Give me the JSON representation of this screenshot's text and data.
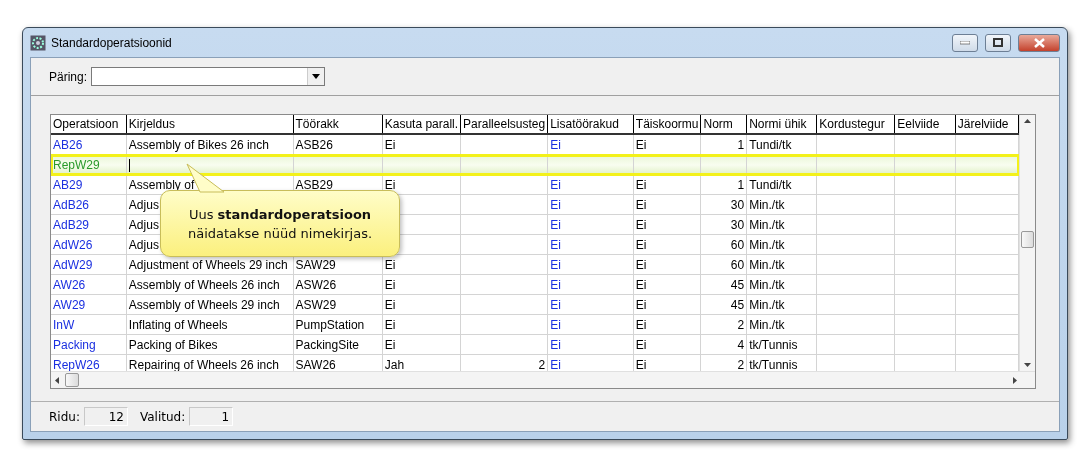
{
  "window": {
    "title": "Standardoperatsioonid"
  },
  "query": {
    "label": "Päring:"
  },
  "table": {
    "columns": [
      {
        "label": "Operatsioon",
        "kind": "link"
      },
      {
        "label": "Kirjeldus",
        "kind": "text"
      },
      {
        "label": "Töörakk",
        "kind": "text"
      },
      {
        "label": "Kasuta parall.",
        "kind": "text"
      },
      {
        "label": "Paralleelsusteg",
        "kind": "number"
      },
      {
        "label": "Lisatöörakud",
        "kind": "link"
      },
      {
        "label": "Täiskoormu",
        "kind": "text"
      },
      {
        "label": "Norm",
        "kind": "number"
      },
      {
        "label": "Normi ühik",
        "kind": "text"
      },
      {
        "label": "Kordustegur",
        "kind": "text"
      },
      {
        "label": "Eelviide",
        "kind": "text"
      },
      {
        "label": "Järelviide",
        "kind": "text"
      }
    ],
    "rows": [
      {
        "selected": false,
        "cells": [
          "AB26",
          "Assembly of Bikes 26 inch",
          "ASB26",
          "Ei",
          null,
          "Ei",
          "Ei",
          "1",
          "Tundi/tk"
        ]
      },
      {
        "selected": true,
        "editing": true,
        "cells": [
          "RepW29"
        ]
      },
      {
        "selected": false,
        "cells": [
          "AB29",
          "Assembly of",
          "ASB29",
          "Ei",
          null,
          "Ei",
          "Ei",
          "1",
          "Tundi/tk"
        ]
      },
      {
        "selected": false,
        "cells": [
          "AdB26",
          "Adjus",
          null,
          null,
          null,
          "Ei",
          "Ei",
          "30",
          "Min./tk"
        ]
      },
      {
        "selected": false,
        "cells": [
          "AdB29",
          "Adjus",
          null,
          null,
          null,
          "Ei",
          "Ei",
          "30",
          "Min./tk"
        ]
      },
      {
        "selected": false,
        "cells": [
          "AdW26",
          "Adjus",
          null,
          null,
          null,
          "Ei",
          "Ei",
          "60",
          "Min./tk"
        ]
      },
      {
        "selected": false,
        "cells": [
          "AdW29",
          "Adjustment of Wheels 29 inch",
          "SAW29",
          "Ei",
          null,
          "Ei",
          "Ei",
          "60",
          "Min./tk"
        ]
      },
      {
        "selected": false,
        "cells": [
          "AW26",
          "Assembly of Wheels 26 inch",
          "ASW26",
          "Ei",
          null,
          "Ei",
          "Ei",
          "45",
          "Min./tk"
        ]
      },
      {
        "selected": false,
        "cells": [
          "AW29",
          "Assembly of Wheels 29 inch",
          "ASW29",
          "Ei",
          null,
          "Ei",
          "Ei",
          "45",
          "Min./tk"
        ]
      },
      {
        "selected": false,
        "cells": [
          "InW",
          "Inflating of Wheels",
          "PumpStation",
          "Ei",
          null,
          "Ei",
          "Ei",
          "2",
          "Min./tk"
        ]
      },
      {
        "selected": false,
        "cells": [
          "Packing",
          "Packing of Bikes",
          "PackingSite",
          "Ei",
          null,
          "Ei",
          "Ei",
          "4",
          "tk/Tunnis"
        ]
      },
      {
        "selected": false,
        "cells": [
          "RepW26",
          "Repairing of Wheels 26 inch",
          "SAW26",
          "Jah",
          "2",
          "Ei",
          "Ei",
          "2",
          "tk/Tunnis"
        ]
      }
    ]
  },
  "callout": {
    "text": "Uus **standardoperatsioon** näidatakse nüüd nimekirjas."
  },
  "status_bar": [
    {
      "label": "Ridu:",
      "value": "12"
    },
    {
      "label": "Valitud:",
      "value": "1"
    }
  ]
}
